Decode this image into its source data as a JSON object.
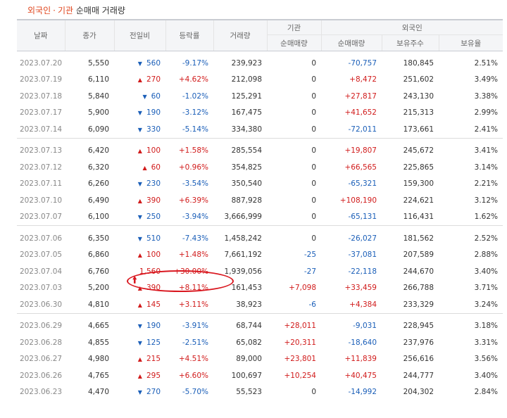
{
  "title": {
    "foreign": "외국인",
    "sep": "·",
    "inst": "기관",
    "rest": "순매매 거래량"
  },
  "headers": {
    "date": "날짜",
    "close": "종가",
    "change": "전일비",
    "rate": "등락률",
    "volume": "거래량",
    "inst_group": "기관",
    "inst_net": "순매매량",
    "foreign_group": "외국인",
    "foreign_net": "순매매량",
    "holding": "보유주수",
    "holding_pct": "보유율"
  },
  "colors": {
    "up": "#d11b1b",
    "down": "#1a5eb8",
    "circle": "#d9171f"
  },
  "highlight": {
    "row_date": "2023.07.04",
    "icon": "up-arrow-icon"
  },
  "groups": [
    [
      {
        "date": "2023.07.20",
        "close": "5,550",
        "dir": "down",
        "change": "560",
        "rate": "-9.17%",
        "volume": "239,923",
        "inst": "0",
        "foreign": "-70,757",
        "holding": "180,845",
        "pct": "2.51%"
      },
      {
        "date": "2023.07.19",
        "close": "6,110",
        "dir": "up",
        "change": "270",
        "rate": "+4.62%",
        "volume": "212,098",
        "inst": "0",
        "foreign": "+8,472",
        "holding": "251,602",
        "pct": "3.49%"
      },
      {
        "date": "2023.07.18",
        "close": "5,840",
        "dir": "down",
        "change": "60",
        "rate": "-1.02%",
        "volume": "125,291",
        "inst": "0",
        "foreign": "+27,817",
        "holding": "243,130",
        "pct": "3.38%"
      },
      {
        "date": "2023.07.17",
        "close": "5,900",
        "dir": "down",
        "change": "190",
        "rate": "-3.12%",
        "volume": "167,475",
        "inst": "0",
        "foreign": "+41,652",
        "holding": "215,313",
        "pct": "2.99%"
      },
      {
        "date": "2023.07.14",
        "close": "6,090",
        "dir": "down",
        "change": "330",
        "rate": "-5.14%",
        "volume": "334,380",
        "inst": "0",
        "foreign": "-72,011",
        "holding": "173,661",
        "pct": "2.41%"
      }
    ],
    [
      {
        "date": "2023.07.13",
        "close": "6,420",
        "dir": "up",
        "change": "100",
        "rate": "+1.58%",
        "volume": "285,554",
        "inst": "0",
        "foreign": "+19,807",
        "holding": "245,672",
        "pct": "3.41%"
      },
      {
        "date": "2023.07.12",
        "close": "6,320",
        "dir": "up",
        "change": "60",
        "rate": "+0.96%",
        "volume": "354,825",
        "inst": "0",
        "foreign": "+66,565",
        "holding": "225,865",
        "pct": "3.14%"
      },
      {
        "date": "2023.07.11",
        "close": "6,260",
        "dir": "down",
        "change": "230",
        "rate": "-3.54%",
        "volume": "350,540",
        "inst": "0",
        "foreign": "-65,321",
        "holding": "159,300",
        "pct": "2.21%"
      },
      {
        "date": "2023.07.10",
        "close": "6,490",
        "dir": "up",
        "change": "390",
        "rate": "+6.39%",
        "volume": "887,928",
        "inst": "0",
        "foreign": "+108,190",
        "holding": "224,621",
        "pct": "3.12%"
      },
      {
        "date": "2023.07.07",
        "close": "6,100",
        "dir": "down",
        "change": "250",
        "rate": "-3.94%",
        "volume": "3,666,999",
        "inst": "0",
        "foreign": "-65,131",
        "holding": "116,431",
        "pct": "1.62%"
      }
    ],
    [
      {
        "date": "2023.07.06",
        "close": "6,350",
        "dir": "down",
        "change": "510",
        "rate": "-7.43%",
        "volume": "1,458,242",
        "inst": "0",
        "foreign": "-26,027",
        "holding": "181,562",
        "pct": "2.52%"
      },
      {
        "date": "2023.07.05",
        "close": "6,860",
        "dir": "up",
        "change": "100",
        "rate": "+1.48%",
        "volume": "7,661,192",
        "inst": "-25",
        "foreign": "-37,081",
        "holding": "207,589",
        "pct": "2.88%"
      },
      {
        "date": "2023.07.04",
        "close": "6,760",
        "dir": "upper",
        "change": "1,560",
        "rate": "+30.00%",
        "volume": "1,939,056",
        "inst": "-27",
        "foreign": "-22,118",
        "holding": "244,670",
        "pct": "3.40%"
      },
      {
        "date": "2023.07.03",
        "close": "5,200",
        "dir": "up",
        "change": "390",
        "rate": "+8.11%",
        "volume": "161,453",
        "inst": "+7,098",
        "foreign": "+33,459",
        "holding": "266,788",
        "pct": "3.71%"
      },
      {
        "date": "2023.06.30",
        "close": "4,810",
        "dir": "up",
        "change": "145",
        "rate": "+3.11%",
        "volume": "38,923",
        "inst": "-6",
        "foreign": "+4,384",
        "holding": "233,329",
        "pct": "3.24%"
      }
    ],
    [
      {
        "date": "2023.06.29",
        "close": "4,665",
        "dir": "down",
        "change": "190",
        "rate": "-3.91%",
        "volume": "68,744",
        "inst": "+28,011",
        "foreign": "-9,031",
        "holding": "228,945",
        "pct": "3.18%"
      },
      {
        "date": "2023.06.28",
        "close": "4,855",
        "dir": "down",
        "change": "125",
        "rate": "-2.51%",
        "volume": "65,082",
        "inst": "+20,311",
        "foreign": "-18,640",
        "holding": "237,976",
        "pct": "3.31%"
      },
      {
        "date": "2023.06.27",
        "close": "4,980",
        "dir": "up",
        "change": "215",
        "rate": "+4.51%",
        "volume": "89,000",
        "inst": "+23,801",
        "foreign": "+11,839",
        "holding": "256,616",
        "pct": "3.56%"
      },
      {
        "date": "2023.06.26",
        "close": "4,765",
        "dir": "up",
        "change": "295",
        "rate": "+6.60%",
        "volume": "100,697",
        "inst": "+10,254",
        "foreign": "+40,475",
        "holding": "244,777",
        "pct": "3.40%"
      },
      {
        "date": "2023.06.23",
        "close": "4,470",
        "dir": "down",
        "change": "270",
        "rate": "-5.70%",
        "volume": "55,523",
        "inst": "0",
        "foreign": "-14,992",
        "holding": "204,302",
        "pct": "2.84%"
      }
    ]
  ]
}
